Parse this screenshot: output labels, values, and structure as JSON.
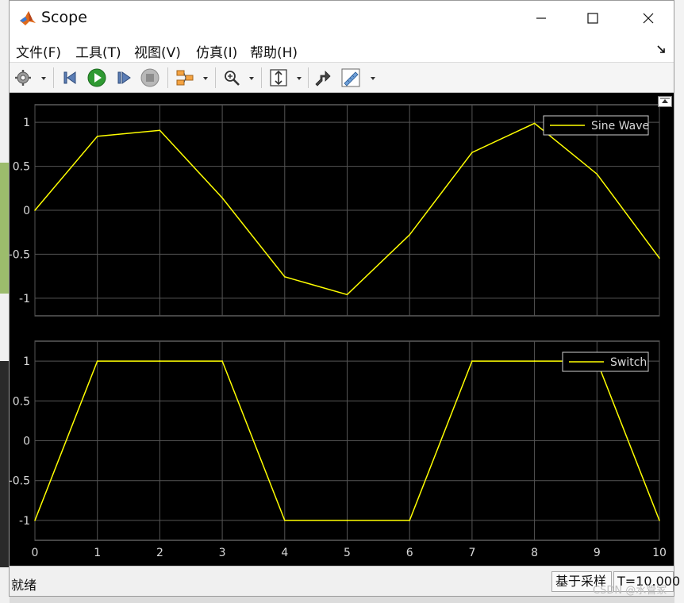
{
  "window": {
    "title": "Scope"
  },
  "menu": {
    "items": [
      "文件(F)",
      "工具(T)",
      "视图(V)",
      "仿真(I)",
      "帮助(H)"
    ]
  },
  "toolbar": {
    "icons": [
      "gear-icon",
      "restore-step-icon",
      "run-icon",
      "step-forward-icon",
      "stop-icon",
      "signal-select-icon",
      "zoom-icon",
      "scale-axes-icon",
      "highlight-block-icon",
      "measurement-icon"
    ]
  },
  "colors": {
    "trace": "#ffff00",
    "plot_background": "#000000",
    "grid": "#555555",
    "axis_text": "#d9d9d9"
  },
  "chart_data": [
    {
      "type": "line",
      "series": [
        {
          "name": "Sine Wave",
          "x": [
            0,
            1,
            2,
            3,
            4,
            5,
            6,
            7,
            8,
            9,
            10
          ],
          "y": [
            0,
            0.841,
            0.909,
            0.141,
            -0.757,
            -0.959,
            -0.279,
            0.657,
            0.989,
            0.412,
            -0.544
          ]
        }
      ],
      "xlim": [
        0,
        10
      ],
      "ylim": [
        -1.2,
        1.2
      ],
      "yticks": [
        -1,
        -0.5,
        0,
        0.5,
        1
      ],
      "ytick_labels": [
        "-1",
        "-0.5",
        "0",
        "0.5",
        "1"
      ],
      "grid": true,
      "legend": "top-right"
    },
    {
      "type": "line",
      "series": [
        {
          "name": "Switch",
          "x": [
            0,
            1,
            2,
            3,
            4,
            5,
            6,
            7,
            8,
            9,
            10
          ],
          "y": [
            -1,
            1,
            1,
            1,
            -1,
            -1,
            -1,
            1,
            1,
            1,
            -1
          ]
        }
      ],
      "xlim": [
        0,
        10
      ],
      "ylim": [
        -1.25,
        1.25
      ],
      "xticks": [
        0,
        1,
        2,
        3,
        4,
        5,
        6,
        7,
        8,
        9,
        10
      ],
      "xtick_labels": [
        "0",
        "1",
        "2",
        "3",
        "4",
        "5",
        "6",
        "7",
        "8",
        "9",
        "10"
      ],
      "yticks": [
        -1,
        -0.5,
        0,
        0.5,
        1
      ],
      "ytick_labels": [
        "-1",
        "-0.5",
        "0",
        "0.5",
        "1"
      ],
      "grid": true,
      "legend": "top-right"
    }
  ],
  "status": {
    "ready": "就绪",
    "mode": "基于采样",
    "time": "T=10.000"
  },
  "watermark": "CSDN @水管家"
}
